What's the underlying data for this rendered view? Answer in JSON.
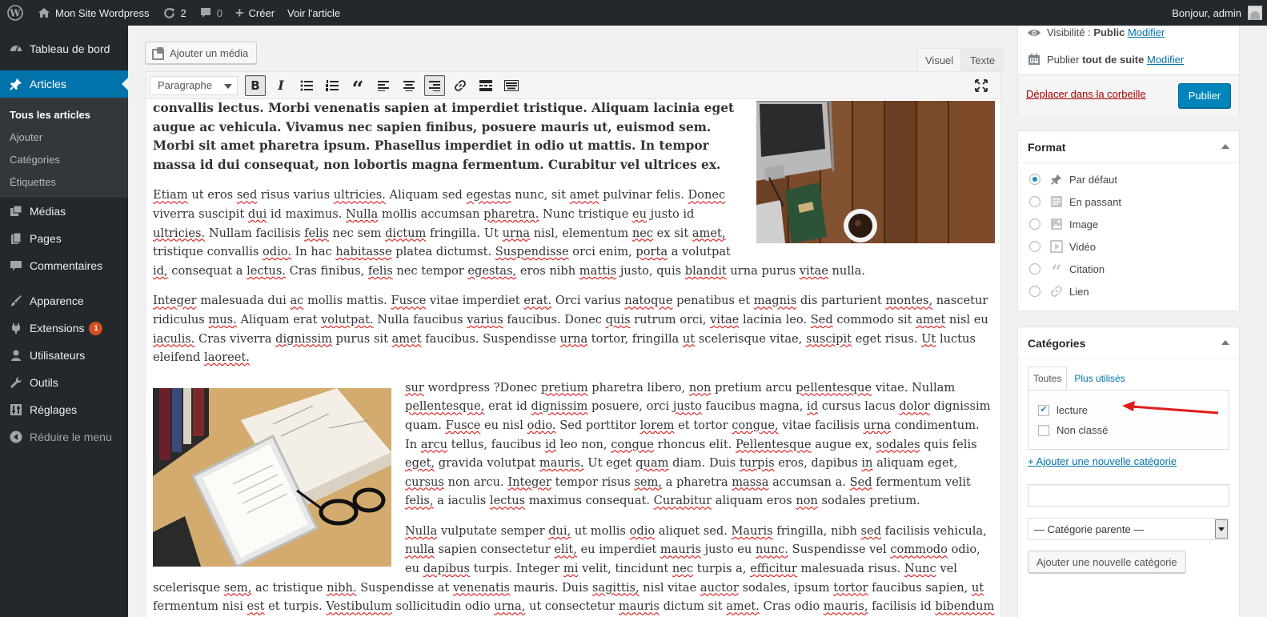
{
  "adminbar": {
    "site_name": "Mon Site Wordpress",
    "updates_count": "2",
    "comments_count": "0",
    "new_label": "Créer",
    "view_label": "Voir l'article",
    "greeting": "Bonjour, admin"
  },
  "menu": {
    "items": [
      {
        "label": "Tableau de bord",
        "icon": "dashboard-icon"
      },
      {
        "label": "Articles",
        "icon": "pin-icon",
        "current": true
      },
      {
        "label": "Médias",
        "icon": "media-icon"
      },
      {
        "label": "Pages",
        "icon": "pages-icon"
      },
      {
        "label": "Commentaires",
        "icon": "comments-icon"
      },
      {
        "label": "Apparence",
        "icon": "appearance-icon"
      },
      {
        "label": "Extensions",
        "icon": "plugins-icon",
        "badge": "1"
      },
      {
        "label": "Utilisateurs",
        "icon": "users-icon"
      },
      {
        "label": "Outils",
        "icon": "tools-icon"
      },
      {
        "label": "Réglages",
        "icon": "settings-icon"
      },
      {
        "label": "Réduire le menu",
        "icon": "collapse-icon"
      }
    ],
    "submenu": [
      "Tous les articles",
      "Ajouter",
      "Catégories",
      "Étiquettes"
    ]
  },
  "editor": {
    "add_media": "Ajouter un média",
    "tab_visual": "Visuel",
    "tab_text": "Texte",
    "format_select": "Paragraphe",
    "paragraphs": [
      "convallis lectus. Morbi venenatis sapien at imperdiet tristique. Aliquam lacinia eget augue ac vehicula. Vivamus nec sapien finibus, posuere mauris ut, euismod sem. Morbi sit amet pharetra ipsum. Phasellus imperdiet in odio ut mattis. In tempor massa id dui consequat, non lobortis magna fermentum. Curabitur vel ultrices ex.",
      "Etiam ut eros sed risus varius ultricies. Aliquam sed egestas nunc, sit amet pulvinar felis. Donec viverra suscipit dui id maximus. Nulla mollis accumsan pharetra. Nunc tristique eu justo id ultricies. Nullam facilisis felis nec sem dictum fringilla. Ut urna nisl, elementum nec ex sit amet, tristique convallis odio. In hac habitasse platea dictumst. Suspendisse orci enim, porta a volutpat id, consequat a lectus. Cras finibus, felis nec tempor  egestas, eros nibh mattis justo, quis blandit urna purus vitae nulla.",
      "Integer malesuada dui ac mollis mattis. Fusce vitae imperdiet erat. Orci varius natoque penatibus et magnis dis parturient montes, nascetur ridiculus mus. Aliquam erat volutpat. Nulla faucibus varius faucibus. Donec quis rutrum orci, vitae lacinia leo. Sed commodo sit amet nisl eu iaculis. Cras viverra dignissim purus sit amet faucibus. Suspendisse urna tortor, fringilla ut scelerisque vitae, suscipit eget risus. Ut luctus eleifend laoreet.",
      "sur wordpress ?Donec pretium pharetra libero, non pretium arcu pellentesque vitae. Nullam pellentesque, erat id dignissim posuere, orci justo faucibus magna, id cursus lacus dolor dignissim quam. Fusce eu nisl odio. Sed porttitor lorem et tortor congue, vitae facilisis urna condimentum. In arcu tellus, faucibus id leo non, congue rhoncus elit. Pellentesque augue ex, sodales quis felis eget, gravida volutpat mauris. Ut eget quam diam. Duis turpis eros, dapibus in aliquam eget, cursus non arcu. Integer tempor risus sem, a pharetra massa accumsan a. Sed fermentum velit felis, a iaculis lectus maximus consequat. Curabitur aliquam eros non sodales pretium.",
      "Nulla vulputate semper dui, ut mollis odio aliquet sed. Mauris fringilla, nibh sed facilisis vehicula, nulla sapien consectetur elit, eu imperdiet mauris justo eu nunc. Suspendisse vel commodo odio, eu dapibus turpis. Integer mi velit, tincidunt nec turpis a, efficitur malesuada risus. Nunc vel scelerisque sem, ac tristique nibh. Suspendisse at venenatis mauris. Duis sagittis, nisl vitae auctor sodales, ipsum tortor faucibus sapien, ut fermentum nisi est et turpis. Vestibulum sollicitudin odio urna, ut consectetur mauris dictum sit amet. Cras odio mauris, facilisis id bibendum sit amet, facilisis eu arcu."
    ]
  },
  "publish": {
    "visibility_label": "Visibilité :",
    "visibility_value": "Public",
    "visibility_edit": "Modifier",
    "publish_label": "Publier",
    "publish_value": "tout de suite",
    "publish_edit": "Modifier",
    "trash": "Déplacer dans la corbeille",
    "publish_button": "Publier"
  },
  "format": {
    "title": "Format",
    "options": [
      {
        "label": "Par défaut",
        "icon": "pin-icon",
        "checked": true
      },
      {
        "label": "En passant",
        "icon": "aside-icon"
      },
      {
        "label": "Image",
        "icon": "image-icon"
      },
      {
        "label": "Vidéo",
        "icon": "video-icon"
      },
      {
        "label": "Citation",
        "icon": "quote-icon"
      },
      {
        "label": "Lien",
        "icon": "link-icon"
      }
    ]
  },
  "categories": {
    "title": "Catégories",
    "tab_all": "Toutes",
    "tab_popular": "Plus utilisés",
    "items": [
      {
        "label": "lecture",
        "checked": true
      },
      {
        "label": "Non classé",
        "checked": false
      }
    ],
    "add_link": "+ Ajouter une nouvelle catégorie",
    "parent_select": "— Catégorie parente —",
    "add_button": "Ajouter une nouvelle catégorie"
  },
  "colors": {
    "adminbar_bg": "#23282d",
    "menu_current": "#0073aa",
    "publish_button": "#0085ba",
    "annotation_arrow": "#e31b1b"
  }
}
